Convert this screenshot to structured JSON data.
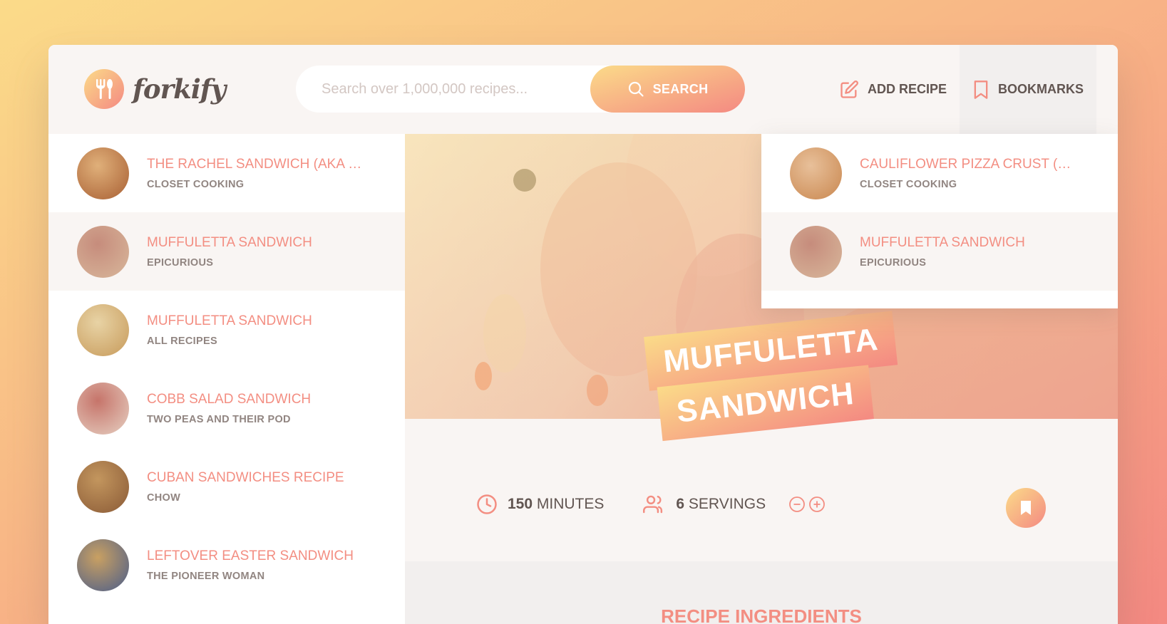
{
  "header": {
    "logo_text": "forkify",
    "search_placeholder": "Search over 1,000,000 recipes...",
    "search_button": "SEARCH",
    "nav": {
      "add_recipe": "ADD RECIPE",
      "bookmarks": "BOOKMARKS"
    }
  },
  "results": [
    {
      "title": "THE RACHEL SANDWICH (AKA RO...",
      "publisher": "CLOSET COOKING",
      "thumb": [
        "#a85f33",
        "#e0b07a"
      ]
    },
    {
      "title": "MUFFULETTA SANDWICH",
      "publisher": "EPICURIOUS",
      "thumb": [
        "#d8b79b",
        "#c68c7c"
      ]
    },
    {
      "title": "MUFFULETTA SANDWICH",
      "publisher": "ALL RECIPES",
      "thumb": [
        "#c79a5a",
        "#e8d3a5"
      ]
    },
    {
      "title": "COBB SALAD SANDWICH",
      "publisher": "TWO PEAS AND THEIR POD",
      "thumb": [
        "#e6d0c2",
        "#c6746a"
      ]
    },
    {
      "title": "CUBAN SANDWICHES RECIPE",
      "publisher": "CHOW",
      "thumb": [
        "#8a5a36",
        "#c3965e"
      ]
    },
    {
      "title": "LEFTOVER EASTER SANDWICH",
      "publisher": "THE PIONEER WOMAN",
      "thumb": [
        "#4a5d8a",
        "#c9a062"
      ]
    }
  ],
  "bookmarks": [
    {
      "title": "CAULIFLOWER PIZZA CRUST (WIT...",
      "publisher": "CLOSET COOKING",
      "thumb": [
        "#c9874f",
        "#e8c09a"
      ]
    },
    {
      "title": "MUFFULETTA SANDWICH",
      "publisher": "EPICURIOUS",
      "thumb": [
        "#d8b79b",
        "#c68c7c"
      ]
    }
  ],
  "recipe": {
    "title_line1": "MUFFULETTA",
    "title_line2": "SANDWICH",
    "minutes": "150",
    "minutes_label": "MINUTES",
    "servings": "6",
    "servings_label": "SERVINGS",
    "ingredients_heading": "RECIPE INGREDIENTS"
  },
  "colors": {
    "accent": "#f38e82",
    "gradient_start": "#fbdb89",
    "gradient_end": "#f48982"
  }
}
